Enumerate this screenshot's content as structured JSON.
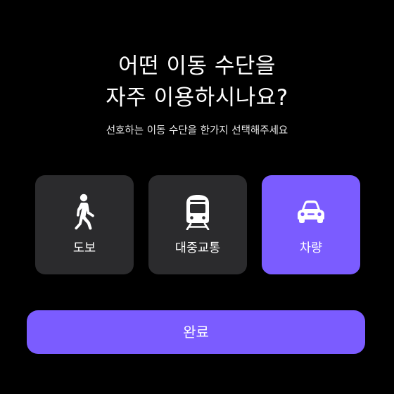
{
  "header": {
    "title_line1": "어떤 이동 수단을",
    "title_line2": "자주 이용하시나요?",
    "subtitle": "선호하는 이동 수단을 한가지 선택해주세요"
  },
  "options": [
    {
      "label": "도보",
      "icon": "walking-person-icon",
      "selected": false
    },
    {
      "label": "대중교통",
      "icon": "train-icon",
      "selected": false
    },
    {
      "label": "차량",
      "icon": "car-icon",
      "selected": true
    }
  ],
  "done_button": {
    "label": "완료"
  },
  "colors": {
    "background": "#000000",
    "card": "#2b2b2d",
    "accent": "#7b5cff",
    "text": "#ffffff"
  }
}
